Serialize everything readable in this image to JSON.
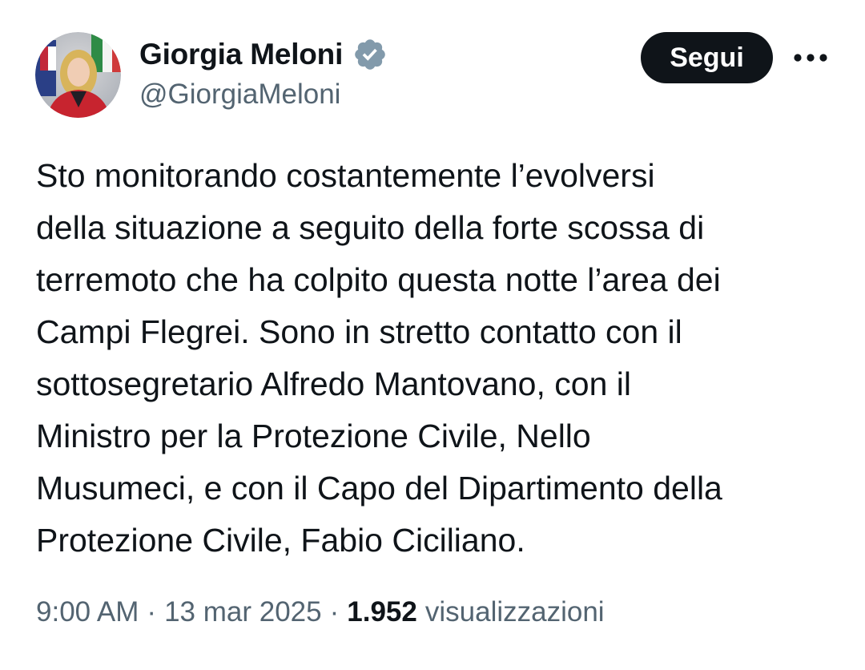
{
  "author": {
    "name": "Giorgia Meloni",
    "handle": "@GiorgiaMeloni",
    "verified": true,
    "avatar_icon": "profile-photo"
  },
  "actions": {
    "follow_label": "Segui",
    "more_icon": "more-horizontal-icon"
  },
  "tweet": {
    "lines": [
      "Sto monitorando costantemente l’evolversi",
      "della situazione a seguito della forte scossa di",
      "terremoto che ha colpito questa notte l’area dei",
      "Campi Flegrei. Sono in stretto contatto con il",
      "sottosegretario Alfredo Mantovano, con il",
      "Ministro per la Protezione Civile, Nello",
      "Musumeci, e con il Capo del Dipartimento della",
      "Protezione Civile, Fabio Ciciliano."
    ]
  },
  "meta": {
    "time": "9:00 AM",
    "date": "13 mar 2025",
    "separator": "·",
    "views_count": "1.952",
    "views_label": "visualizzazioni"
  },
  "colors": {
    "text_primary": "#0f1419",
    "text_secondary": "#536471",
    "button_bg": "#0f1419",
    "button_text": "#ffffff",
    "verified_badge": "#829aab",
    "background": "#ffffff"
  }
}
